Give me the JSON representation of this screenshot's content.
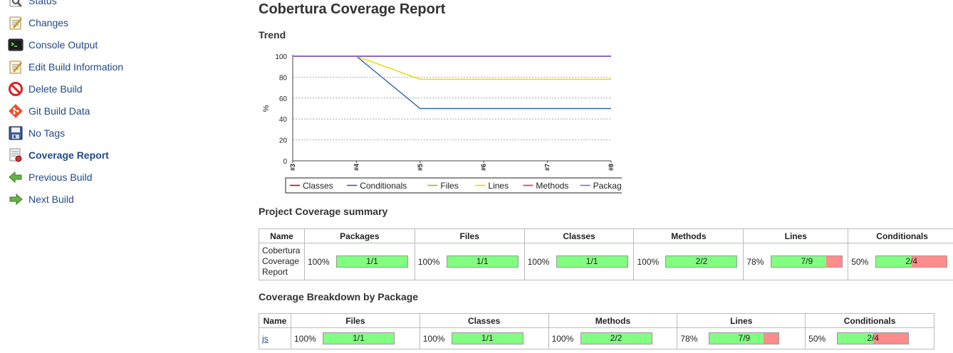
{
  "sidebar": {
    "items": [
      {
        "label": "Status",
        "icon": "search-icon",
        "active": false
      },
      {
        "label": "Changes",
        "icon": "notepad-icon",
        "active": false
      },
      {
        "label": "Console Output",
        "icon": "terminal-icon",
        "active": false
      },
      {
        "label": "Edit Build Information",
        "icon": "notepad-icon",
        "active": false
      },
      {
        "label": "Delete Build",
        "icon": "no-entry-icon",
        "active": false
      },
      {
        "label": "Git Build Data",
        "icon": "git-icon",
        "active": false
      },
      {
        "label": "No Tags",
        "icon": "floppy-disk-icon",
        "active": false
      },
      {
        "label": "Coverage Report",
        "icon": "coverage-report-icon",
        "active": true
      },
      {
        "label": "Previous Build",
        "icon": "arrow-left-icon",
        "active": false
      },
      {
        "label": "Next Build",
        "icon": "arrow-right-icon",
        "active": false
      }
    ]
  },
  "main": {
    "title": "Cobertura Coverage Report",
    "trend_heading": "Trend",
    "summary_heading": "Project Coverage summary",
    "breakdown_heading": "Coverage Breakdown by Package"
  },
  "chart_data": {
    "type": "line",
    "ylabel": "%",
    "ylim": [
      0,
      100
    ],
    "yticks": [
      0,
      20,
      40,
      60,
      80,
      100
    ],
    "categories": [
      "#3",
      "#4",
      "#5",
      "#6",
      "#7",
      "#8"
    ],
    "grid": true,
    "legend_position": "bottom",
    "series": [
      {
        "name": "Classes",
        "color": "#cc0000",
        "values": [
          100,
          100,
          100,
          100,
          100,
          100
        ]
      },
      {
        "name": "Conditionals",
        "color": "#3465a4",
        "values": [
          100,
          100,
          50,
          50,
          50,
          50
        ]
      },
      {
        "name": "Files",
        "color": "#73d216",
        "values": [
          100,
          100,
          100,
          100,
          100,
          100
        ]
      },
      {
        "name": "Lines",
        "color": "#edd400",
        "values": [
          100,
          100,
          78,
          78,
          78,
          78
        ]
      },
      {
        "name": "Methods",
        "color": "#ef2929",
        "values": [
          100,
          100,
          100,
          100,
          100,
          100
        ]
      },
      {
        "name": "Packages",
        "color": "#7b68ee",
        "values": [
          100,
          100,
          100,
          100,
          100,
          100
        ]
      }
    ]
  },
  "summary_table": {
    "headers": [
      "Name",
      "Packages",
      "Files",
      "Classes",
      "Methods",
      "Lines",
      "Conditionals"
    ],
    "row": {
      "name": "Cobertura Coverage Report",
      "cells": [
        {
          "pct": "100%",
          "ratio": "1/1",
          "fraction": 1.0
        },
        {
          "pct": "100%",
          "ratio": "1/1",
          "fraction": 1.0
        },
        {
          "pct": "100%",
          "ratio": "1/1",
          "fraction": 1.0
        },
        {
          "pct": "100%",
          "ratio": "2/2",
          "fraction": 1.0
        },
        {
          "pct": "78%",
          "ratio": "7/9",
          "fraction": 0.778
        },
        {
          "pct": "50%",
          "ratio": "2/4",
          "fraction": 0.5
        }
      ]
    }
  },
  "breakdown_table": {
    "headers": [
      "Name",
      "Files",
      "Classes",
      "Methods",
      "Lines",
      "Conditionals"
    ],
    "row": {
      "name": "js",
      "cells": [
        {
          "pct": "100%",
          "ratio": "1/1",
          "fraction": 1.0
        },
        {
          "pct": "100%",
          "ratio": "1/1",
          "fraction": 1.0
        },
        {
          "pct": "100%",
          "ratio": "2/2",
          "fraction": 1.0
        },
        {
          "pct": "78%",
          "ratio": "7/9",
          "fraction": 0.778
        },
        {
          "pct": "50%",
          "ratio": "2/4",
          "fraction": 0.5
        }
      ]
    }
  },
  "colors": {
    "link": "#204a87",
    "bar_covered": "#80ff80",
    "bar_uncovered": "#ff8c8c"
  }
}
